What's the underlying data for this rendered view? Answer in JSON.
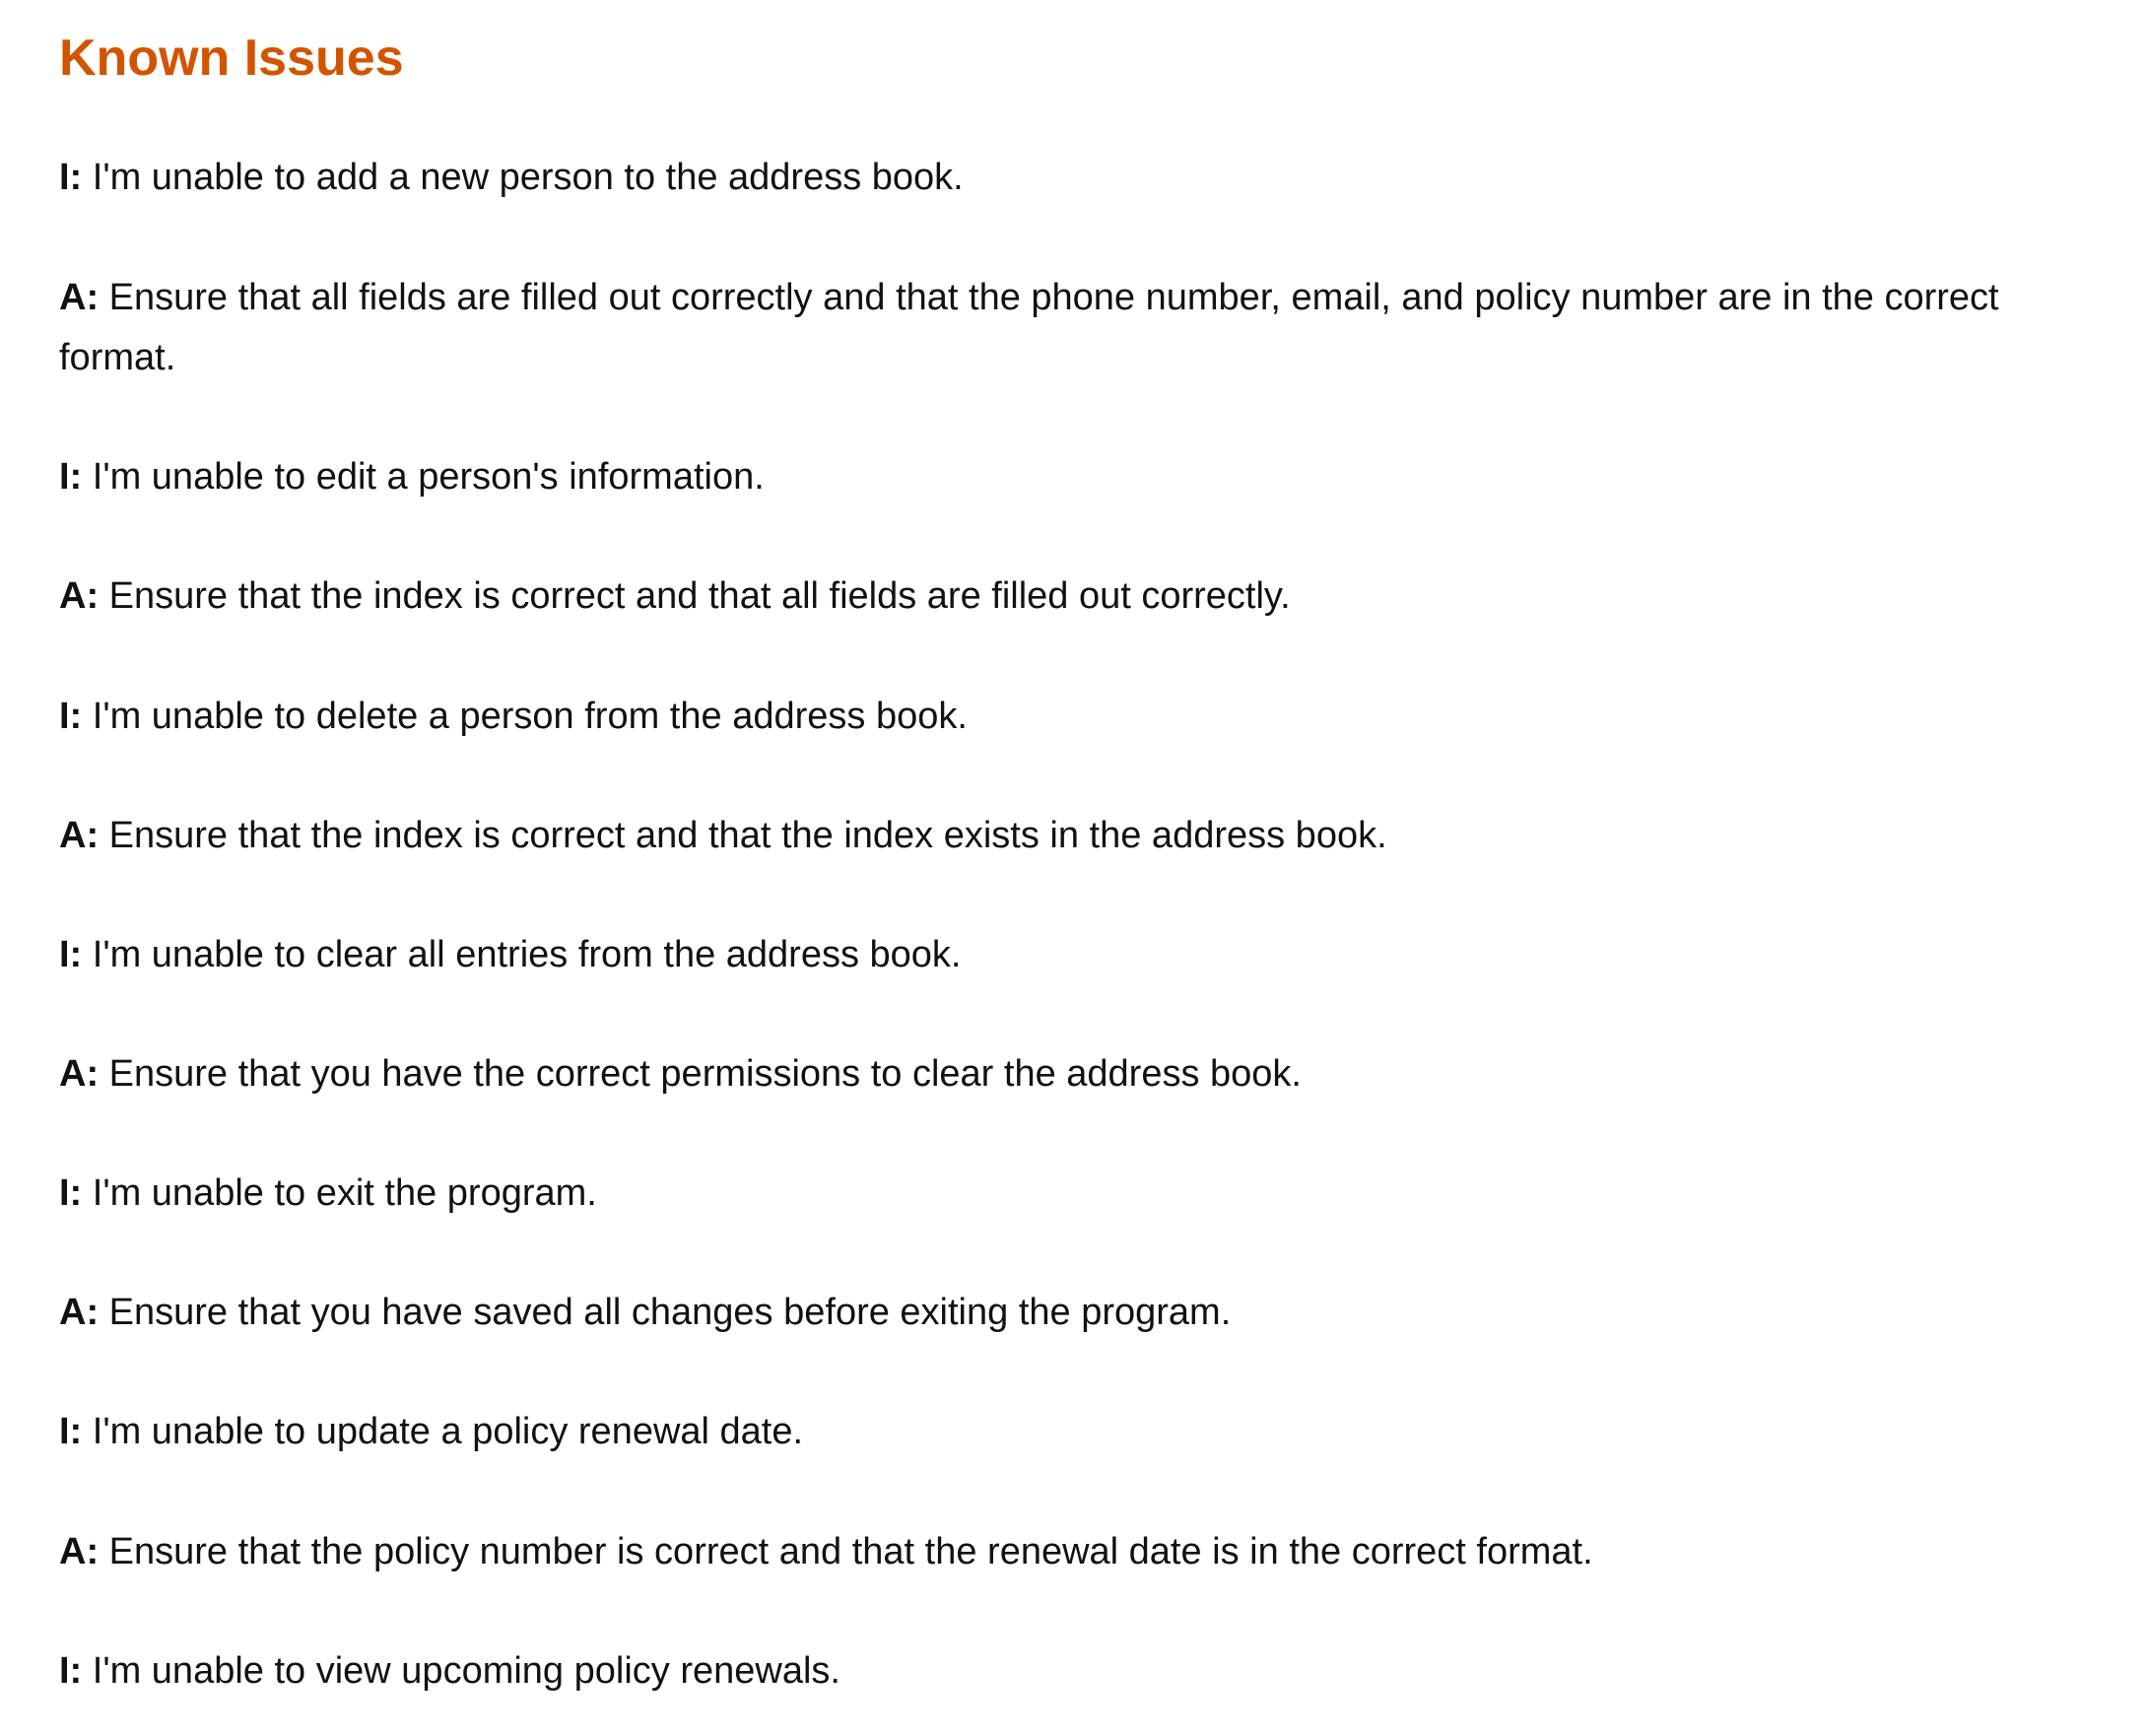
{
  "colors": {
    "heading": "#d35400",
    "text": "#111111",
    "background": "#ffffff"
  },
  "doc": {
    "title": "Known Issues",
    "entries": [
      {
        "tag": "I:",
        "text": " I'm unable to add a new person to the address book."
      },
      {
        "tag": "A:",
        "text": " Ensure that all fields are filled out correctly and that the phone number, email, and policy number are in the correct format."
      },
      {
        "tag": "I:",
        "text": " I'm unable to edit a person's information."
      },
      {
        "tag": "A:",
        "text": " Ensure that the index is correct and that all fields are filled out correctly."
      },
      {
        "tag": "I:",
        "text": " I'm unable to delete a person from the address book."
      },
      {
        "tag": "A:",
        "text": " Ensure that the index is correct and that the index exists in the address book."
      },
      {
        "tag": "I:",
        "text": " I'm unable to clear all entries from the address book."
      },
      {
        "tag": "A:",
        "text": " Ensure that you have the correct permissions to clear the address book."
      },
      {
        "tag": "I:",
        "text": " I'm unable to exit the program."
      },
      {
        "tag": "A:",
        "text": " Ensure that you have saved all changes before exiting the program."
      },
      {
        "tag": "I:",
        "text": " I'm unable to update a policy renewal date."
      },
      {
        "tag": "A:",
        "text": " Ensure that the policy number is correct and that the renewal date is in the correct format."
      },
      {
        "tag": "I:",
        "text": " I'm unable to view upcoming policy renewals."
      }
    ]
  }
}
